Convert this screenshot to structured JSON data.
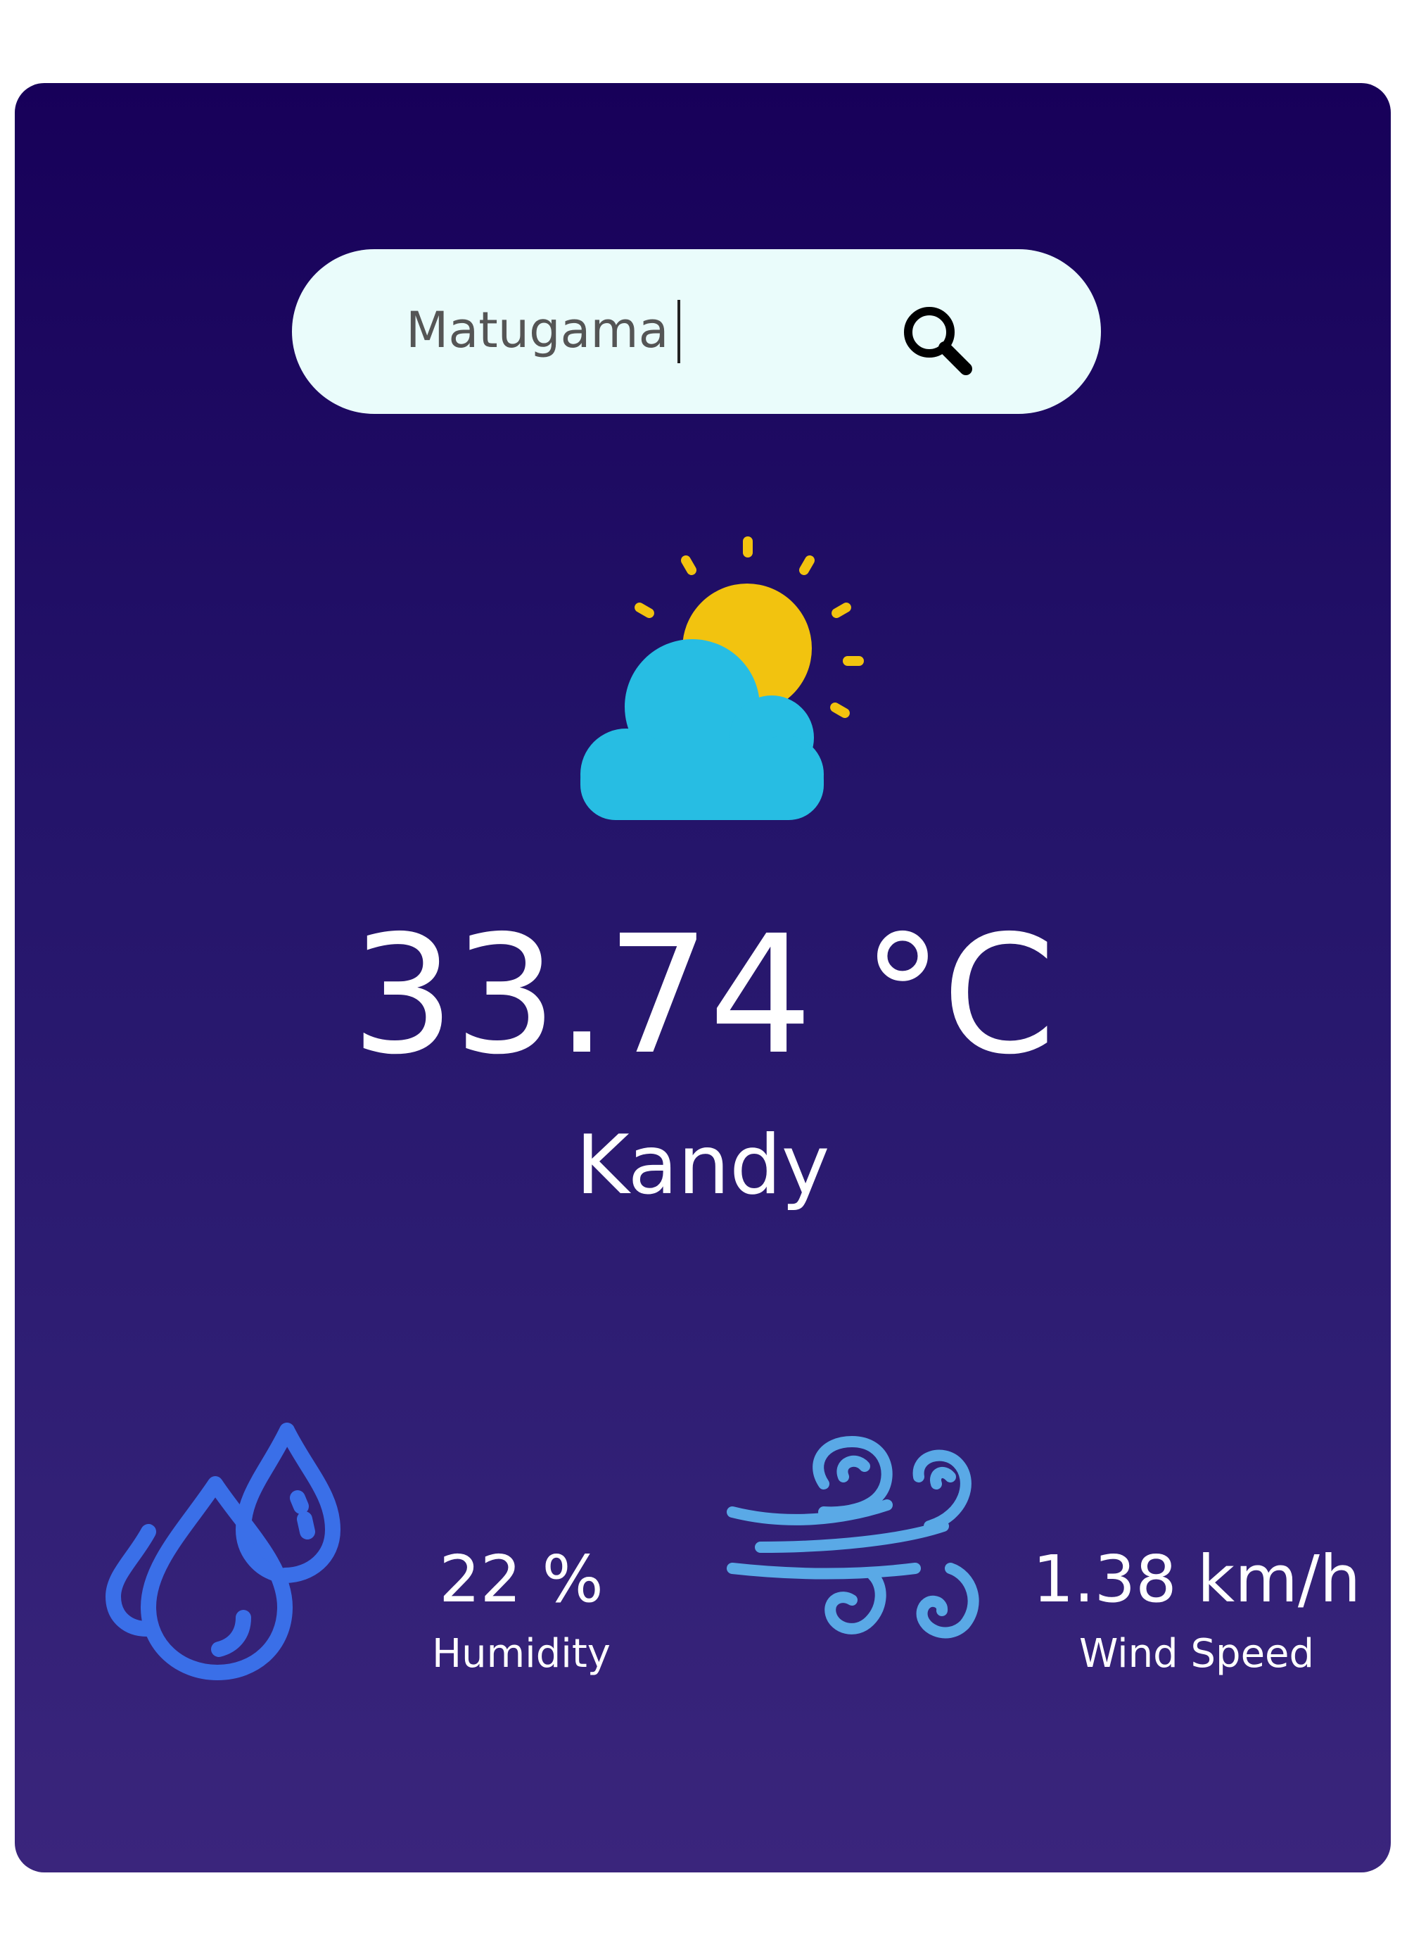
{
  "search": {
    "value": "Matugama",
    "icon": "search-icon"
  },
  "weather": {
    "icon": "sun-behind-cloud-icon",
    "temperature": "33.74 °C",
    "city": "Kandy"
  },
  "details": {
    "humidity": {
      "icon": "water-drops-icon",
      "value": "22 %",
      "label": "Humidity"
    },
    "wind": {
      "icon": "wind-icon",
      "value": "1.38 km/h",
      "label": "Wind Speed"
    }
  },
  "colors": {
    "card_top": "#170059",
    "card_bottom": "#3a257c",
    "search_bg": "#eafcfb",
    "sun": "#f2c30f",
    "cloud": "#27bde3",
    "humidity_icon": "#3a6fe8",
    "wind_icon": "#5aa9e6"
  }
}
